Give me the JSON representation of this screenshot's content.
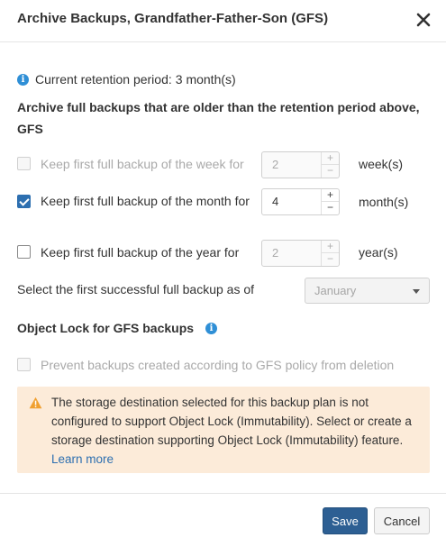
{
  "dialog": {
    "title": "Archive Backups, Grandfather-Father-Son (GFS)"
  },
  "retention": {
    "label": "Current retention period:",
    "value": "3 month(s)"
  },
  "section": {
    "heading": "Archive full backups that are older than the retention period above, GFS"
  },
  "options": [
    {
      "label": "Keep first full backup of the week for",
      "checked": false,
      "enabled": false,
      "value": "2",
      "unit": "week(s)"
    },
    {
      "label": "Keep first full backup of the month for",
      "checked": true,
      "enabled": true,
      "value": "4",
      "unit": "month(s)"
    },
    {
      "label": "Keep first full backup of the year for",
      "checked": false,
      "enabled": true,
      "value": "2",
      "unit": "year(s)"
    }
  ],
  "stepper_symbols": {
    "plus": "+",
    "minus": "−"
  },
  "first_backup": {
    "label": "Select the first successful full backup as of",
    "selected": "January"
  },
  "object_lock": {
    "heading": "Object Lock for GFS backups",
    "prevent_label": "Prevent backups created according to GFS policy from deletion",
    "prevent_checked": false,
    "warning": "The storage destination selected for this backup plan is not configured to support Object Lock (Immutability). Select or create a storage destination supporting Object Lock (Immutability) feature.",
    "learn_more": "Learn more"
  },
  "footer": {
    "save_label": "Save",
    "cancel_label": "Cancel"
  },
  "colors": {
    "accent": "#2d6fb0",
    "info": "#2f8fd6",
    "warning_bg": "#fcebd9",
    "warning_icon": "#f0a030",
    "save_bg": "#2d5f93"
  },
  "icons": {
    "close": "close-icon",
    "info": "info-icon",
    "warning": "warning-icon",
    "dropdown": "chevron-down-icon"
  }
}
